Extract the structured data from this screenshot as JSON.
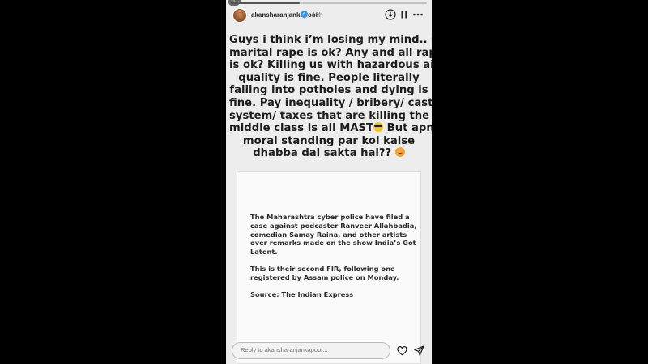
{
  "story": {
    "progress_fraction": 0.35,
    "header": {
      "username": "akansharanjankapoor",
      "time": "19h",
      "icons": [
        "avatar",
        "verified-badge-icon",
        "download-icon",
        "pause-icon",
        "more-icon"
      ]
    },
    "caption": {
      "lines": [
        "Guys i think i’m losing my mind.. so",
        "marital rape is ok? Any and all rape",
        "is ok? Killing us with hazardous air",
        "quality is fine. People literally",
        "falling into potholes and dying is",
        "fine. Pay inequality / bribery/ cast",
        "system/ taxes that are killing the",
        "middle class is all MAST",
        "But apne",
        "moral standing par koi kaise",
        "dhabba dal sakta hai??"
      ],
      "emojis": [
        "smiling-face-with-sunglasses-emoji",
        "angry-face-emoji"
      ]
    },
    "card": {
      "paragraphs": [
        "The Maharashtra cyber police have filed a case against podcaster Ranveer Allahbadia, comedian Samay Raina, and other artists over remarks made on the show India’s Got Latent.",
        "This is their second FIR, following one registered by Assam police on Monday.",
        "Source: The Indian Express"
      ]
    },
    "reply": {
      "placeholder": "Reply to akansharanjankapoor..."
    },
    "footer_icons": [
      "heart-icon",
      "send-icon"
    ]
  },
  "colors": {
    "background": "#000000",
    "story_bg": "#ededed",
    "card_bg": "#fafafa",
    "verified": "#3797f0"
  }
}
